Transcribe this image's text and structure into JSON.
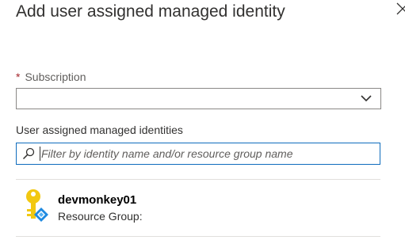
{
  "blade": {
    "title": "Add user assigned managed identity"
  },
  "subscription": {
    "required_mark": "*",
    "label": "Subscription",
    "selected_value": ""
  },
  "identities": {
    "label": "User assigned managed identities",
    "search_placeholder": "Filter by identity name and/or resource group name",
    "search_value": "",
    "items": [
      {
        "name": "devmonkey01",
        "resource_group_label": "Resource Group:",
        "icon": "managed-identity-key-icon"
      }
    ]
  },
  "colors": {
    "accent": "#0f6cbd",
    "required": "#a4262c",
    "key_gold": "#f2c811",
    "badge_blue": "#1f8ae0"
  }
}
